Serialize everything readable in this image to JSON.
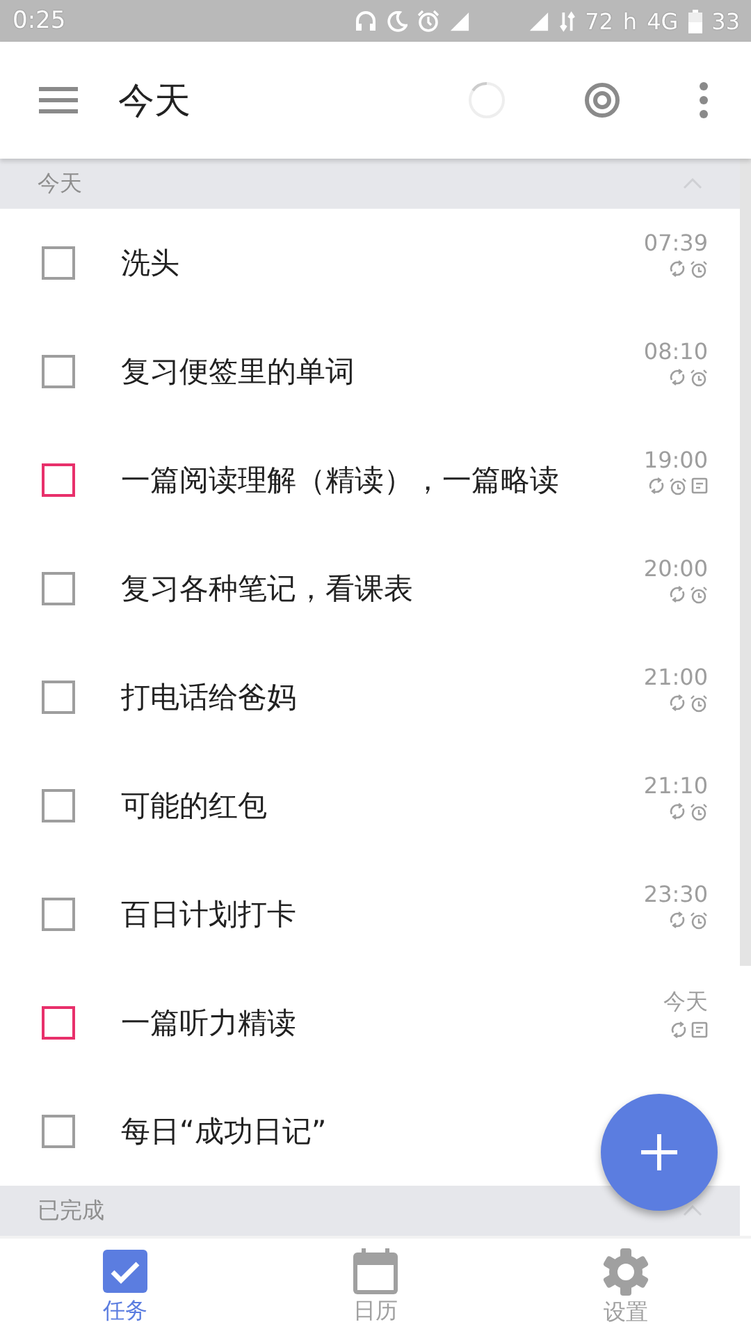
{
  "status_bar": {
    "time": "0:25",
    "network": "72",
    "network_unit": "h",
    "network_type": "4G",
    "battery": "33"
  },
  "app_bar": {
    "title": "今天",
    "loading": true
  },
  "sections": [
    {
      "title": "今天",
      "expanded": true,
      "tasks": [
        {
          "title": "洗头",
          "color": "#9e9e9e",
          "time": "07:39",
          "repeat": true,
          "alarm": true,
          "note": false
        },
        {
          "title": "复习便签里的单词",
          "color": "#9e9e9e",
          "time": "08:10",
          "repeat": true,
          "alarm": true,
          "note": false
        },
        {
          "title": "一篇阅读理解（精读），一篇略读",
          "color": "#e8306b",
          "time": "19:00",
          "repeat": true,
          "alarm": true,
          "note": true
        },
        {
          "title": "复习各种笔记，看课表",
          "color": "#9e9e9e",
          "time": "20:00",
          "repeat": true,
          "alarm": true,
          "note": false
        },
        {
          "title": "打电话给爸妈",
          "color": "#9e9e9e",
          "time": "21:00",
          "repeat": true,
          "alarm": true,
          "note": false
        },
        {
          "title": "可能的红包",
          "color": "#9e9e9e",
          "time": "21:10",
          "repeat": true,
          "alarm": true,
          "note": false
        },
        {
          "title": "百日计划打卡",
          "color": "#9e9e9e",
          "time": "23:30",
          "repeat": true,
          "alarm": true,
          "note": false
        },
        {
          "title": "一篇听力精读",
          "color": "#e8306b",
          "time": "今天",
          "repeat": true,
          "alarm": false,
          "note": true
        },
        {
          "title": "每日“成功日记”",
          "color": "#9e9e9e"
        }
      ]
    },
    {
      "title": "已完成",
      "expanded": true
    }
  ],
  "bottom_nav": [
    {
      "kind": "tasks",
      "label": "任务",
      "selected": true
    },
    {
      "kind": "calendar",
      "label": "日历",
      "selected": false
    },
    {
      "kind": "settings",
      "label": "设置",
      "selected": false
    }
  ]
}
